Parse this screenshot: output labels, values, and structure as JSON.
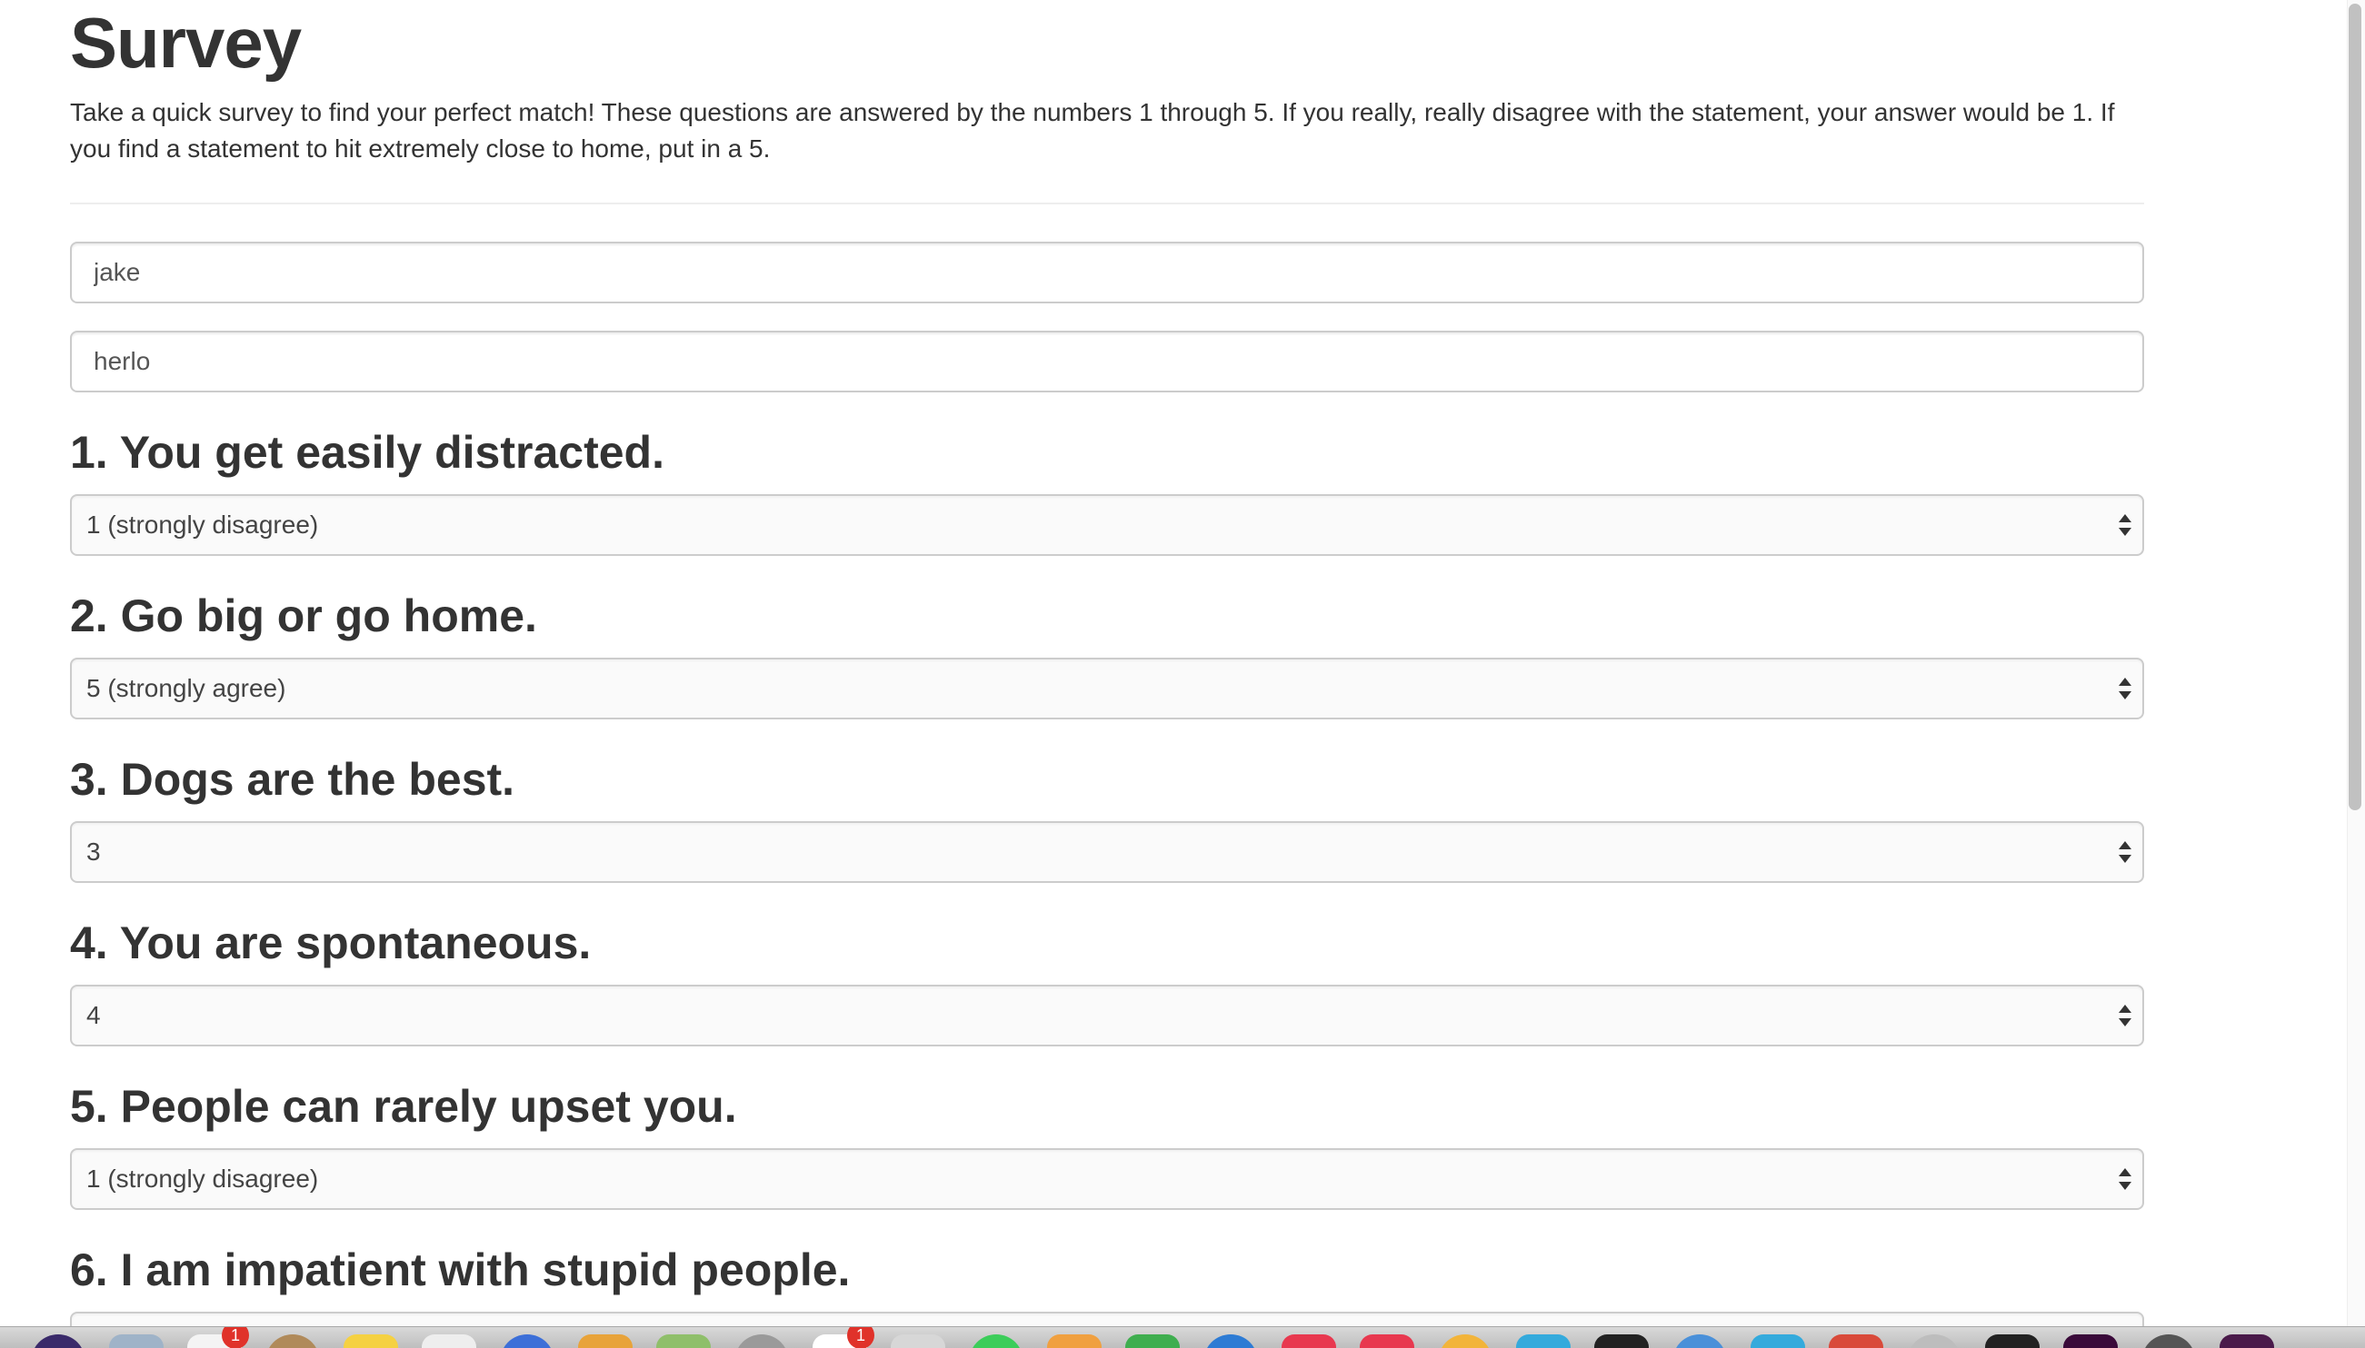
{
  "page": {
    "title": "Survey",
    "intro": "Take a quick survey to find your perfect match! These questions are answered by the numbers 1 through 5. If you really, really disagree with the statement, your answer would be 1. If you find a statement to hit extremely close to home, put in a 5."
  },
  "form": {
    "name_value": "jake",
    "photo_value": "herlo"
  },
  "questions": [
    {
      "label": "1. You get easily distracted.",
      "selected": "1 (strongly disagree)"
    },
    {
      "label": "2. Go big or go home.",
      "selected": "5 (strongly agree)"
    },
    {
      "label": "3. Dogs are the best.",
      "selected": "3"
    },
    {
      "label": "4. You are spontaneous.",
      "selected": "4"
    },
    {
      "label": "5. People can rarely upset you.",
      "selected": "1 (strongly disagree)"
    },
    {
      "label": "6. I am impatient with stupid people."
    }
  ],
  "dock": {
    "icons": [
      {
        "name": "app-icon",
        "color": "#3a2a6a"
      },
      {
        "name": "app-icon",
        "color": "#9fb3c8"
      },
      {
        "name": "calendar-icon",
        "color": "#f4f4f4",
        "badge": "1"
      },
      {
        "name": "app-icon",
        "color": "#b08a5a"
      },
      {
        "name": "notes-icon",
        "color": "#f5d142"
      },
      {
        "name": "app-icon",
        "color": "#eeeeee"
      },
      {
        "name": "app-icon",
        "color": "#3c6fd8"
      },
      {
        "name": "browser-icon",
        "color": "#e8a33a"
      },
      {
        "name": "app-icon",
        "color": "#8fbf6a"
      },
      {
        "name": "app-icon",
        "color": "#9a9a9a"
      },
      {
        "name": "calendar-icon",
        "color": "#ffffff",
        "badge": "1"
      },
      {
        "name": "app-icon",
        "color": "#d7d7d7"
      },
      {
        "name": "messages-icon",
        "color": "#3ccd5a"
      },
      {
        "name": "app-icon",
        "color": "#f0a040"
      },
      {
        "name": "app-icon",
        "color": "#3fae4f"
      },
      {
        "name": "app-icon",
        "color": "#2d7bd4"
      },
      {
        "name": "app-icon",
        "color": "#e8384f"
      },
      {
        "name": "app-icon",
        "color": "#e8384f"
      },
      {
        "name": "app-icon",
        "color": "#f2b43a"
      },
      {
        "name": "app-icon",
        "color": "#34aadc"
      },
      {
        "name": "app-icon",
        "color": "#222222"
      },
      {
        "name": "app-icon",
        "color": "#4a90d9"
      },
      {
        "name": "app-icon",
        "color": "#34aadc"
      },
      {
        "name": "app-icon",
        "color": "#d94a3a"
      },
      {
        "name": "app-icon",
        "color": "#bdbdbd"
      },
      {
        "name": "terminal-icon",
        "color": "#222222"
      },
      {
        "name": "app-icon",
        "color": "#3a0a3a"
      },
      {
        "name": "app-icon",
        "color": "#555555"
      },
      {
        "name": "app-icon",
        "color": "#4a1a4a"
      }
    ]
  }
}
